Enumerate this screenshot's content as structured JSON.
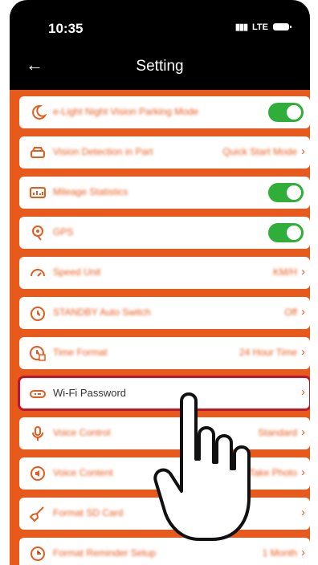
{
  "status": {
    "time": "10:35",
    "network": "LTE"
  },
  "nav": {
    "back_icon": "back-arrow-icon",
    "title": "Setting"
  },
  "colors": {
    "accent": "#e85a1c",
    "toggle_on": "#2fae3a",
    "highlight": "#c0162b"
  },
  "settings": [
    {
      "label": "e-Light Night Vision Parking Mode",
      "icon": "moon-icon",
      "control": "toggle",
      "on": true
    },
    {
      "label": "Vision Detection in Part",
      "icon": "car-front-icon",
      "value": "Quick Start Mode",
      "control": "chevron"
    },
    {
      "label": "Mileage Statistics",
      "icon": "chart-icon",
      "control": "toggle",
      "on": true
    },
    {
      "label": "GPS",
      "icon": "location-icon",
      "control": "toggle",
      "on": true
    },
    {
      "label": "Speed Unit",
      "icon": "speedometer-icon",
      "value": "KM/H",
      "control": "chevron"
    },
    {
      "label": "STANDBY Auto Switch",
      "icon": "timer-icon",
      "value": "Off",
      "control": "chevron"
    },
    {
      "label": "Time Format",
      "icon": "clock-icon",
      "value": "24 Hour Time",
      "control": "chevron"
    },
    {
      "label": "Wi-Fi Password",
      "icon": "wifi-router-icon",
      "value": "",
      "control": "chevron"
    },
    {
      "label": "Voice Control",
      "icon": "microphone-icon",
      "value": "Standard",
      "control": "chevron"
    },
    {
      "label": "Voice Content",
      "icon": "speaker-icon",
      "value": "Take Photo",
      "control": "chevron"
    },
    {
      "label": "Format SD Card",
      "icon": "broom-icon",
      "value": "",
      "control": "chevron"
    },
    {
      "label": "Format Reminder Setup",
      "icon": "reminder-icon",
      "value": "1 Month",
      "control": "chevron"
    }
  ]
}
